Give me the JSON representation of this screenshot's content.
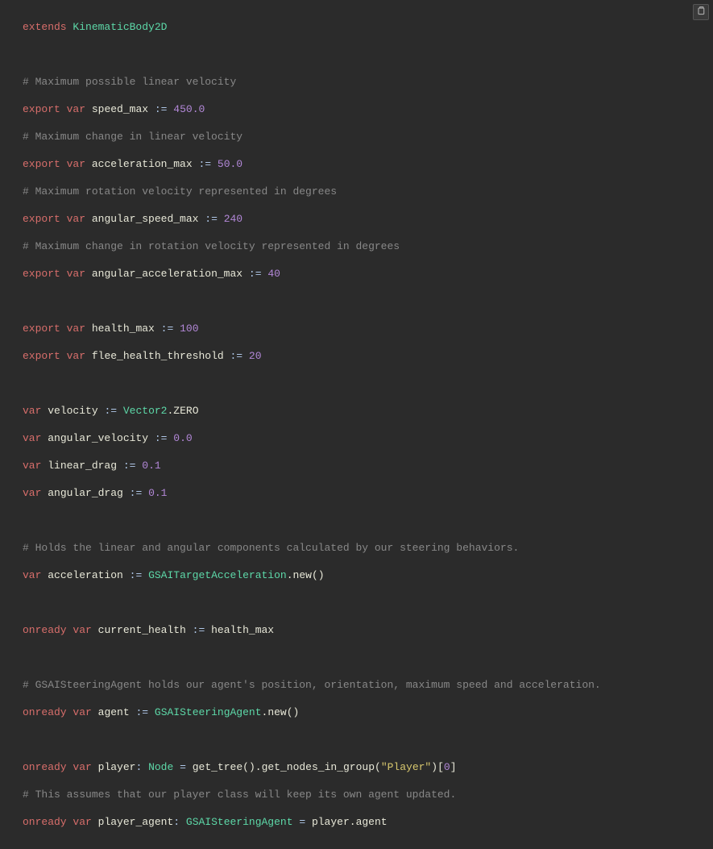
{
  "code": {
    "l1_extends": "extends",
    "l1_type": "KinematicBody2D",
    "l3_comment": "# Maximum possible linear velocity",
    "l4_export": "export",
    "l4_var": "var",
    "l4_name": "speed_max",
    "l4_op": ":=",
    "l4_val": "450.0",
    "l5_comment": "# Maximum change in linear velocity",
    "l6_export": "export",
    "l6_var": "var",
    "l6_name": "acceleration_max",
    "l6_op": ":=",
    "l6_val": "50.0",
    "l7_comment": "# Maximum rotation velocity represented in degrees",
    "l8_export": "export",
    "l8_var": "var",
    "l8_name": "angular_speed_max",
    "l8_op": ":=",
    "l8_val": "240",
    "l9_comment": "# Maximum change in rotation velocity represented in degrees",
    "l10_export": "export",
    "l10_var": "var",
    "l10_name": "angular_acceleration_max",
    "l10_op": ":=",
    "l10_val": "40",
    "l12_export": "export",
    "l12_var": "var",
    "l12_name": "health_max",
    "l12_op": ":=",
    "l12_val": "100",
    "l13_export": "export",
    "l13_var": "var",
    "l13_name": "flee_health_threshold",
    "l13_op": ":=",
    "l13_val": "20",
    "l15_var": "var",
    "l15_name": "velocity",
    "l15_op": ":=",
    "l15_type": "Vector2",
    "l15_dot": ".",
    "l15_val": "ZERO",
    "l16_var": "var",
    "l16_name": "angular_velocity",
    "l16_op": ":=",
    "l16_val": "0.0",
    "l17_var": "var",
    "l17_name": "linear_drag",
    "l17_op": ":=",
    "l17_val": "0.1",
    "l18_var": "var",
    "l18_name": "angular_drag",
    "l18_op": ":=",
    "l18_val": "0.1",
    "l20_comment": "# Holds the linear and angular components calculated by our steering behaviors.",
    "l21_var": "var",
    "l21_name": "acceleration",
    "l21_op": ":=",
    "l21_type": "GSAITargetAcceleration",
    "l21_dot": ".",
    "l21_new": "new",
    "l21_paren": "()",
    "l23_onready": "onready",
    "l23_var": "var",
    "l23_name": "current_health",
    "l23_op": ":=",
    "l23_val": "health_max",
    "l25_comment": "# GSAISteeringAgent holds our agent's position, orientation, maximum speed and acceleration.",
    "l26_onready": "onready",
    "l26_var": "var",
    "l26_name": "agent",
    "l26_op": ":=",
    "l26_type": "GSAISteeringAgent",
    "l26_dot": ".",
    "l26_new": "new",
    "l26_paren": "()",
    "l28_onready": "onready",
    "l28_var": "var",
    "l28_name": "player",
    "l28_colon": ":",
    "l28_ptype": "Node",
    "l28_eq": "=",
    "l28_f1": "get_tree",
    "l28_p1": "()",
    "l28_d1": ".",
    "l28_f2": "get_nodes_in_group",
    "l28_p2a": "(",
    "l28_str": "\"Player\"",
    "l28_p2b": ")",
    "l28_br1": "[",
    "l28_idx": "0",
    "l28_br2": "]",
    "l29_comment": "# This assumes that our player class will keep its own agent updated.",
    "l30_onready": "onready",
    "l30_var": "var",
    "l30_name": "player_agent",
    "l30_colon": ":",
    "l30_ptype": "GSAISteeringAgent",
    "l30_eq": "=",
    "l30_lhs": "player",
    "l30_dot": ".",
    "l30_rhs": "agent"
  }
}
